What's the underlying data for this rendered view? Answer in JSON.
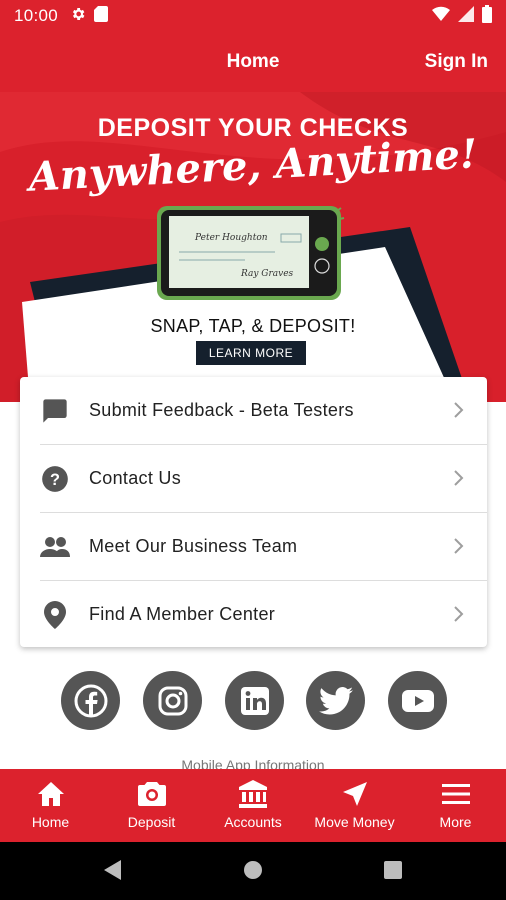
{
  "status_bar": {
    "time": "10:00"
  },
  "app_bar": {
    "title": "Home",
    "sign_in": "Sign In"
  },
  "banner": {
    "headline": "DEPOSIT YOUR CHECKS",
    "script_line": "Anywhere, Anytime!",
    "check_payee": "Peter Houghton",
    "check_signature": "Ray Graves",
    "tagline": "SNAP, TAP, & DEPOSIT!",
    "cta": "LEARN MORE"
  },
  "menu": {
    "items": [
      {
        "label": "Submit Feedback - Beta Testers",
        "icon": "feedback-icon"
      },
      {
        "label": "Contact Us",
        "icon": "help-icon"
      },
      {
        "label": "Meet Our Business Team",
        "icon": "people-icon"
      },
      {
        "label": "Find A Member Center",
        "icon": "location-pin-icon"
      }
    ]
  },
  "social": [
    "facebook-icon",
    "instagram-icon",
    "linkedin-icon",
    "twitter-icon",
    "youtube-icon"
  ],
  "footer_text": "Mobile App Information",
  "bottom_nav": {
    "items": [
      {
        "label": "Home",
        "icon": "home-icon"
      },
      {
        "label": "Deposit",
        "icon": "camera-icon"
      },
      {
        "label": "Accounts",
        "icon": "bank-icon"
      },
      {
        "label": "Move Money",
        "icon": "navigation-arrow-icon"
      },
      {
        "label": "More",
        "icon": "menu-icon"
      }
    ]
  },
  "colors": {
    "brand_red": "#dc222d",
    "banner_red": "#d8202b",
    "navy": "#15202d",
    "icon_gray": "#555555",
    "phone_green": "#6aa84f"
  }
}
